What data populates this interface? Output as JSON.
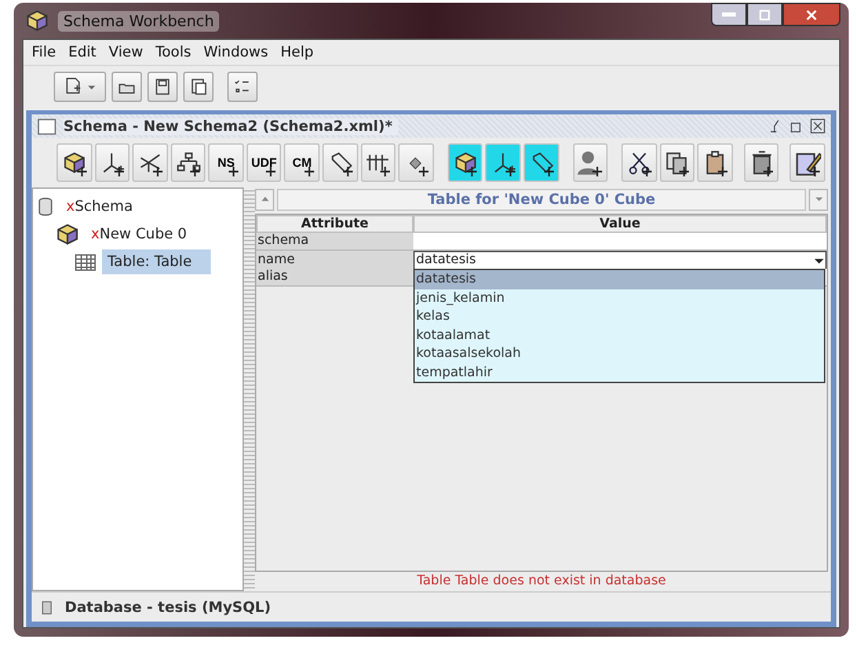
{
  "window": {
    "title": "Schema Workbench"
  },
  "menu": [
    {
      "label": "File"
    },
    {
      "label": "Edit"
    },
    {
      "label": "View"
    },
    {
      "label": "Tools"
    },
    {
      "label": "Windows"
    },
    {
      "label": "Help"
    }
  ],
  "main_toolbar": [
    {
      "kind": "new",
      "dropdown": true
    },
    {
      "kind": "open",
      "dropdown": false
    },
    {
      "kind": "save",
      "dropdown": false
    },
    {
      "kind": "saveas",
      "dropdown": false
    },
    {
      "kind": "list",
      "dropdown": false
    }
  ],
  "schema_window": {
    "title": "Schema - New Schema2 (Schema2.xml)*",
    "toolbar": [
      {
        "kind": "cube",
        "active": false
      },
      {
        "kind": "dimension",
        "active": false
      },
      {
        "kind": "hierarchy",
        "active": false
      },
      {
        "kind": "tree",
        "active": false
      },
      {
        "kind": "text",
        "label": "NS",
        "active": false
      },
      {
        "kind": "text",
        "label": "UDF",
        "active": false
      },
      {
        "kind": "text",
        "label": "CM",
        "active": false
      },
      {
        "kind": "tag",
        "active": false
      },
      {
        "kind": "levels",
        "active": false
      },
      {
        "kind": "diamond",
        "active": false
      },
      {
        "kind": "cube",
        "active": true
      },
      {
        "kind": "dimension",
        "active": true
      },
      {
        "kind": "tag",
        "active": true
      },
      {
        "kind": "user",
        "active": false
      },
      {
        "kind": "cut",
        "active": false
      },
      {
        "kind": "copy",
        "active": false
      },
      {
        "kind": "paste",
        "active": false
      },
      {
        "kind": "delete",
        "active": false
      },
      {
        "kind": "edit",
        "active": false
      }
    ],
    "tree": [
      {
        "kind": "schema",
        "marker": "x",
        "label": "Schema",
        "selected": false,
        "children": [
          {
            "kind": "cube",
            "marker": "x",
            "label": "New Cube 0",
            "selected": false,
            "children": [
              {
                "kind": "table",
                "label": "Table: Table",
                "selected": true
              }
            ]
          }
        ]
      }
    ],
    "panel_title": "Table for 'New Cube 0' Cube",
    "table": {
      "columns": [
        "Attribute",
        "Value"
      ],
      "rows": [
        {
          "attribute": "schema"
        },
        {
          "attribute": "name",
          "value": "datatesis",
          "dropdown": {
            "open": true,
            "options": [
              {
                "label": "datatesis",
                "selected": true
              },
              {
                "label": "jenis_kelamin",
                "selected": false
              },
              {
                "label": "kelas",
                "selected": false
              },
              {
                "label": "kotaalamat",
                "selected": false
              },
              {
                "label": "kotaasalsekolah",
                "selected": false
              },
              {
                "label": "tempatlahir",
                "selected": false
              }
            ]
          }
        },
        {
          "attribute": "alias"
        }
      ]
    },
    "message": "Table Table does not exist in database",
    "status_bar": "Database - tesis (MySQL)"
  }
}
